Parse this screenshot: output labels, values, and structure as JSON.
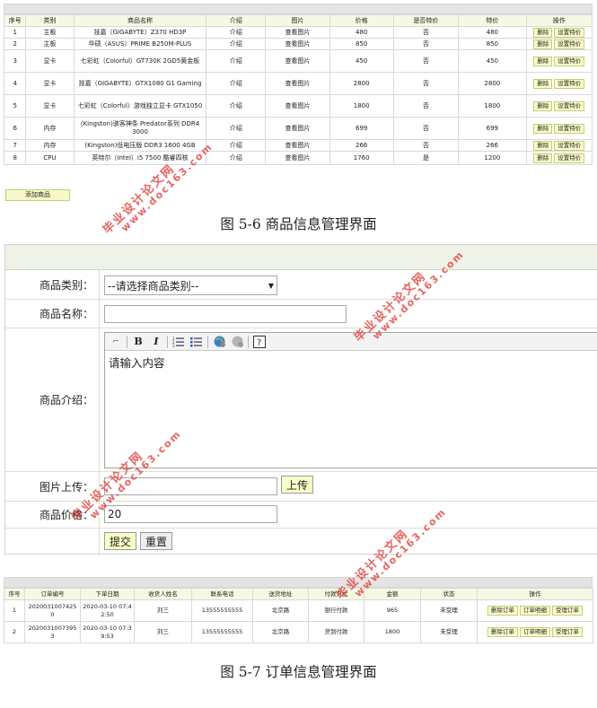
{
  "products": {
    "headers": [
      "序号",
      "类别",
      "商品名称",
      "介绍",
      "图片",
      "价格",
      "是否特价",
      "特价",
      "操作"
    ],
    "rows": [
      {
        "no": "1",
        "category": "主板",
        "name": "技嘉（GIGABYTE）Z370 HD3P",
        "intro": "介绍",
        "image": "查看图片",
        "price": "480",
        "special": "否",
        "special_price": "480"
      },
      {
        "no": "2",
        "category": "主板",
        "name": "华硕（ASUS）PRIME B250M-PLUS",
        "intro": "介绍",
        "image": "查看图片",
        "price": "850",
        "special": "否",
        "special_price": "850"
      },
      {
        "no": "3",
        "category": "显卡",
        "name": "七彩虹（Colorful）GT730K 2GD5黄金板",
        "intro": "介绍",
        "image": "查看图片",
        "price": "450",
        "special": "否",
        "special_price": "450"
      },
      {
        "no": "4",
        "category": "显卡",
        "name": "技嘉（GIGABYTE）GTX1080 G1 Gaming",
        "intro": "介绍",
        "image": "查看图片",
        "price": "2800",
        "special": "否",
        "special_price": "2800"
      },
      {
        "no": "5",
        "category": "显卡",
        "name": "七彩虹（Colorful）游戏独立显卡 GTX1050",
        "intro": "介绍",
        "image": "查看图片",
        "price": "1800",
        "special": "否",
        "special_price": "1800"
      },
      {
        "no": "6",
        "category": "内存",
        "name": "(Kingston)骇客神条 Predator系列 DDR4 3000",
        "intro": "介绍",
        "image": "查看图片",
        "price": "699",
        "special": "否",
        "special_price": "699"
      },
      {
        "no": "7",
        "category": "内存",
        "name": "(Kingston)低电压版 DDR3 1600 4GB",
        "intro": "介绍",
        "image": "查看图片",
        "price": "266",
        "special": "否",
        "special_price": "266"
      },
      {
        "no": "8",
        "category": "CPU",
        "name": "英特尔（Intel）i5 7500 酷睿四核",
        "intro": "介绍",
        "image": "查看图片",
        "price": "1760",
        "special": "是",
        "special_price": "1200"
      }
    ],
    "delete_label": "删除",
    "set_special_label": "设置特价",
    "add_label": "添加商品"
  },
  "caption1": "图 5-6 商品信息管理界面",
  "form": {
    "category_label": "商品类别：",
    "category_selected": "--请选择商品类别--",
    "name_label": "商品名称：",
    "name_value": "",
    "intro_label": "商品介绍：",
    "editor_content": "请输入内容",
    "toolbar_icons": [
      "resize-corner-icon",
      "bold-icon",
      "italic-icon",
      "ordered-list-icon",
      "unordered-list-icon",
      "link-icon",
      "unlink-icon",
      "help-icon"
    ],
    "upload_label": "图片上传：",
    "upload_button": "上传",
    "price_label": "商品价格：",
    "price_value": "20",
    "submit_button": "提交",
    "reset_button": "重置"
  },
  "orders": {
    "headers": [
      "序号",
      "订单编号",
      "下单日期",
      "收货人姓名",
      "联系电话",
      "送货地址",
      "付款方式",
      "金额",
      "状态",
      "操作"
    ],
    "rows": [
      {
        "no": "1",
        "order_no": "20200310074250",
        "date": "2020-03-10 07:42:50",
        "receiver": "刘三",
        "phone": "13555555555",
        "address": "北京路",
        "payment": "银行付款",
        "amount": "965",
        "status": "未受理"
      },
      {
        "no": "2",
        "order_no": "20200310073953",
        "date": "2020-03-10 07:39:53",
        "receiver": "刘三",
        "phone": "13555555555",
        "address": "北京路",
        "payment": "货到付款",
        "amount": "1800",
        "status": "未受理"
      }
    ],
    "delete_label": "删除订单",
    "detail_label": "订单明细",
    "accept_label": "受理订单"
  },
  "caption2": "图 5-7 订单信息管理界面",
  "watermark": {
    "line1": "毕业设计论文网",
    "line2": "www.doc163.com",
    "color": "#e0443f"
  },
  "colors": {
    "header_bg": "#f5f8e3",
    "button_bg": "#fbfdc8",
    "form_header_bg": "#eef2e7"
  }
}
